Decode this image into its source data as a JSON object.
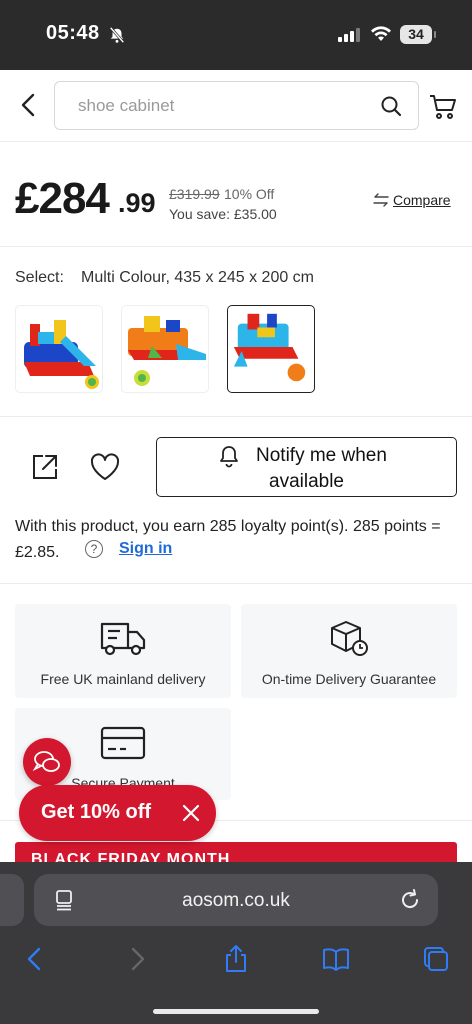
{
  "status_bar": {
    "time": "05:48",
    "battery": "34"
  },
  "header": {
    "search_placeholder": "shoe cabinet"
  },
  "price": {
    "main": "£284",
    "cents": ".99",
    "was": "£319.99",
    "discount": "10% Off",
    "you_save": "You save: £35.00",
    "compare": "Compare"
  },
  "select": {
    "label": "Select:",
    "value": "Multi Colour, 435 x 245 x 200 cm",
    "selected_index": 2
  },
  "notify": {
    "line1": "Notify me when",
    "line2": "available"
  },
  "loyalty": {
    "text": "With this product, you earn 285 loyalty point(s). 285 points = £2.85.",
    "sign_in": "Sign in"
  },
  "features": [
    {
      "icon": "delivery-truck-icon",
      "label": "Free UK mainland delivery"
    },
    {
      "icon": "box-clock-icon",
      "label": "On-time Delivery Guarantee"
    },
    {
      "icon": "credit-card-icon",
      "label": "Secure Payment"
    }
  ],
  "promo": {
    "label": "Get 10% off",
    "banner": "BLACK FRIDAY MONTH"
  },
  "browser": {
    "url": "aosom.co.uk"
  },
  "colors": {
    "brand_red": "#d3172e",
    "link_blue": "#1f6ad6",
    "ios_blue": "#2f7cf6"
  }
}
